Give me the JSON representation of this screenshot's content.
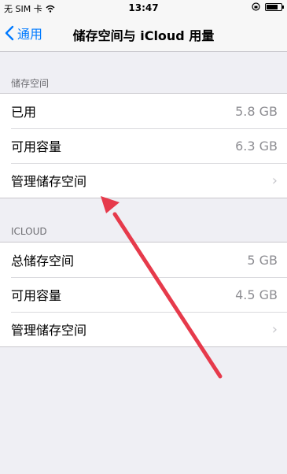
{
  "status_bar": {
    "carrier": "无 SIM 卡",
    "time": "13:47",
    "battery_level": 0.75
  },
  "nav": {
    "back_label": "通用",
    "title": "储存空间与 iCloud 用量"
  },
  "storage": {
    "header": "储存空间",
    "rows": [
      {
        "label": "已用",
        "value": "5.8 GB"
      },
      {
        "label": "可用容量",
        "value": "6.3 GB"
      },
      {
        "label": "管理储存空间"
      }
    ]
  },
  "icloud": {
    "header": "ICLOUD",
    "rows": [
      {
        "label": "总储存空间",
        "value": "5 GB"
      },
      {
        "label": "可用容量",
        "value": "4.5 GB"
      },
      {
        "label": "管理储存空间"
      }
    ]
  },
  "annotation_color": "#e63a4b"
}
